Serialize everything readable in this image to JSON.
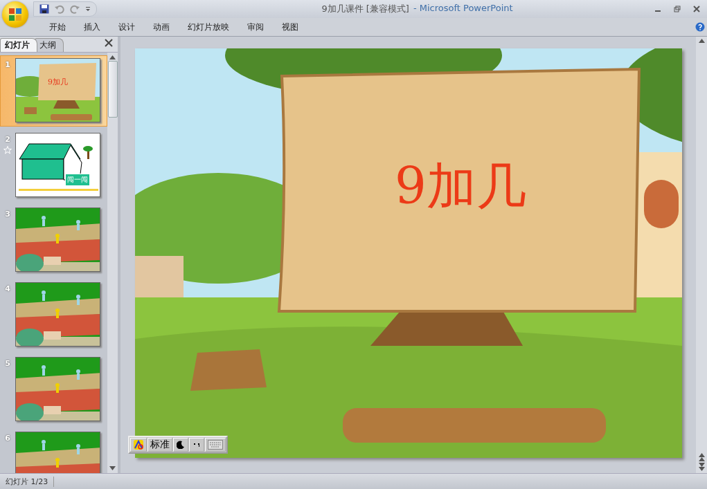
{
  "window": {
    "document_title": "9加几课件 [兼容模式]",
    "app_title": "- Microsoft PowerPoint"
  },
  "ribbon_tabs": [
    "开始",
    "插入",
    "设计",
    "动画",
    "幻灯片放映",
    "审阅",
    "视图"
  ],
  "panel_tabs": [
    {
      "label": "幻灯片",
      "selected": true
    },
    {
      "label": "大纲",
      "selected": false
    }
  ],
  "slides": [
    {
      "number": "1",
      "selected": true,
      "animated": false,
      "kind": "title",
      "text": "9加几"
    },
    {
      "number": "2",
      "selected": false,
      "animated": true,
      "kind": "house",
      "button": "闯一闯"
    },
    {
      "number": "3",
      "selected": false,
      "animated": false,
      "kind": "track"
    },
    {
      "number": "4",
      "selected": false,
      "animated": false,
      "kind": "track"
    },
    {
      "number": "5",
      "selected": false,
      "animated": false,
      "kind": "track"
    },
    {
      "number": "6",
      "selected": false,
      "animated": false,
      "kind": "track"
    }
  ],
  "slide": {
    "title": "9加几"
  },
  "ime_bar": {
    "mode": "标准"
  },
  "status_bar": {
    "slide_count": "幻灯片 1/23"
  }
}
